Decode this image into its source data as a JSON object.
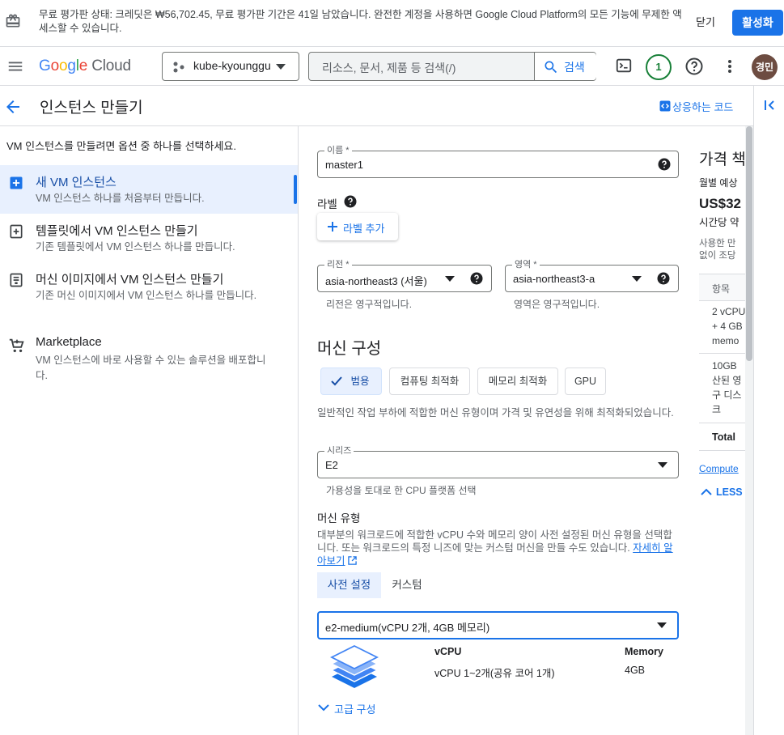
{
  "banner": {
    "text": "무료 평가판 상태: 크레딧은 ₩56,702.45, 무료 평가판 기간은 41일 남았습니다. 완전한 계정을 사용하면 Google Cloud Platform의 모든 기능에 무제한 액세스할 수 있습니다.",
    "dismiss_label": "닫기",
    "activate_label": "활성화"
  },
  "header": {
    "logo_g": "G",
    "logo_o1": "o",
    "logo_o2": "o",
    "logo_g2": "g",
    "logo_l": "l",
    "logo_e": "e",
    "logo_cloud": "Cloud",
    "project_name": "kube-kyounggu",
    "search_placeholder": "리소스, 문서, 제품 등 검색(/)",
    "search_button": "검색",
    "notification_count": "1",
    "avatar_initials": "경민"
  },
  "page": {
    "title": "인스턴스 만들기",
    "code_button": "상응하는 코드"
  },
  "left_panel": {
    "intro": "VM 인스턴스를 만들려면 옵션 중 하나를 선택하세요.",
    "items": [
      {
        "title": "새 VM 인스턴스",
        "subtitle": "VM 인스턴스 하나를 처음부터 만듭니다."
      },
      {
        "title": "템플릿에서 VM 인스턴스 만들기",
        "subtitle": "기존 템플릿에서 VM 인스턴스 하나를 만듭니다."
      },
      {
        "title": "머신 이미지에서 VM 인스턴스 만들기",
        "subtitle": "기존 머신 이미지에서 VM 인스턴스 하나를 만듭니다."
      },
      {
        "title": "Marketplace",
        "subtitle": "VM 인스턴스에 바로 사용할 수 있는 솔루션을 배포합니다."
      }
    ]
  },
  "form": {
    "name_label": "이름 *",
    "name_value": "master1",
    "labels_title": "라벨",
    "add_label_button": "라벨 추가",
    "region_label": "리전 *",
    "region_value": "asia-northeast3 (서울)",
    "region_hint": "리전은 영구적입니다.",
    "zone_label": "영역 *",
    "zone_value": "asia-northeast3-a",
    "zone_hint": "영역은 영구적입니다.",
    "machine_config_title": "머신 구성",
    "machine_families": [
      "범용",
      "컴퓨팅 최적화",
      "메모리 최적화",
      "GPU"
    ],
    "family_desc": "일반적인 작업 부하에 적합한 머신 유형이며 가격 및 유연성을 위해 최적화되었습니다.",
    "series_label": "시리즈",
    "series_value": "E2",
    "series_hint": "가용성을 토대로 한 CPU 플랫폼 선택",
    "machine_type_title": "머신 유형",
    "machine_type_desc": "대부분의 워크로드에 적합한 vCPU 수와 메모리 양이 사전 설정된 머신 유형을 선택합니다. 또는 워크로드의 특정 니즈에 맞는 커스텀 머신을 만들 수도 있습니다.",
    "learn_more": "자세히 알아보기",
    "tabs": [
      "사전 설정",
      "커스텀"
    ],
    "machine_type_value": "e2-medium(vCPU 2개, 4GB 메모리)",
    "spec_vcpu_header": "vCPU",
    "spec_memory_header": "Memory",
    "spec_vcpu_value": "vCPU 1~2개(공유 코어 1개)",
    "spec_memory_value": "4GB",
    "advanced_label": "고급 구성"
  },
  "price_panel": {
    "title": "가격 책",
    "monthly": "월별 예상",
    "amount": "US$32",
    "hourly": "시간당 약",
    "note1": "사용한 만",
    "note2": "없이 조당",
    "col_header": "항목",
    "row1a": "2 vCPU",
    "row1b": "+ 4 GB",
    "row1c": "memo",
    "row2a": "10GB",
    "row2b": "산된 영",
    "row2c": "구 디스",
    "row2d": "크",
    "total": "Total",
    "compute_link": "Compute",
    "less": "LESS"
  },
  "colors": {
    "accent": "#1a73e8",
    "selected_bg": "#e8f0fe",
    "border": "#dadce0"
  },
  "icons": [
    "gift-icon",
    "menu-icon",
    "project-icon",
    "search-icon",
    "cloud-shell-icon",
    "help-icon",
    "more-vert-icon",
    "back-arrow-icon",
    "code-icon",
    "collapse-panel-icon",
    "add-box-icon",
    "template-icon",
    "machine-image-icon",
    "marketplace-icon",
    "help-circle-icon",
    "dropdown-arrow-icon",
    "add-icon",
    "check-icon",
    "open-new-icon",
    "layers-icon",
    "expand-more-icon",
    "expand-less-icon"
  ]
}
